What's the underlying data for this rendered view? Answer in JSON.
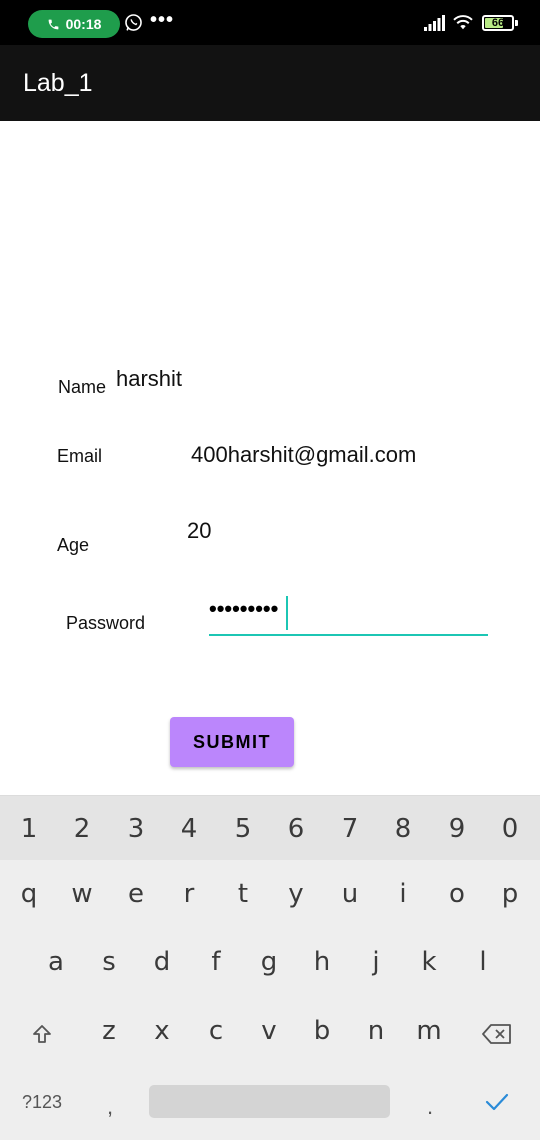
{
  "status_bar": {
    "call_time": "00:18",
    "overflow": "•••",
    "battery": "66",
    "icons": [
      "phone-icon",
      "whatsapp-icon",
      "signal-icon",
      "wifi-icon",
      "battery-icon"
    ]
  },
  "app_bar": {
    "title": "Lab_1"
  },
  "form": {
    "name_label": "Name",
    "name_value": "harshit",
    "email_label": "Email",
    "email_value": "400harshit@gmail.com",
    "age_label": "Age",
    "age_value": "20",
    "password_label": "Password",
    "password_value": "•••••••••",
    "submit_label": "SUBMIT"
  },
  "keyboard": {
    "numbers": [
      "1",
      "2",
      "3",
      "4",
      "5",
      "6",
      "7",
      "8",
      "9",
      "0"
    ],
    "row1": [
      "q",
      "w",
      "e",
      "r",
      "t",
      "y",
      "u",
      "i",
      "o",
      "p"
    ],
    "row2": [
      "a",
      "s",
      "d",
      "f",
      "g",
      "h",
      "j",
      "k",
      "l"
    ],
    "row3": [
      "z",
      "x",
      "c",
      "v",
      "b",
      "n",
      "m"
    ],
    "symbols_key": "?123",
    "comma": ",",
    "period": "."
  },
  "colors": {
    "accent": "#1cc6b4",
    "button": "#bb86fc",
    "app_bar": "#121212",
    "call_pill": "#1f9d4c"
  }
}
